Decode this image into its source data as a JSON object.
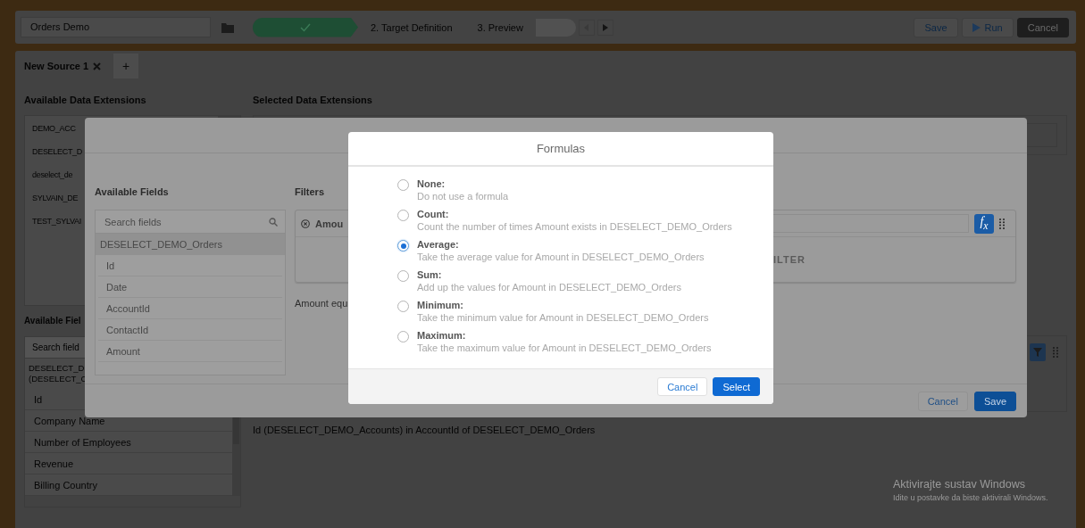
{
  "top_bar": {
    "name_field": "Orders Demo",
    "steps": [
      {
        "completed": true
      },
      {
        "label": "2. Target Definition",
        "completed": false
      },
      {
        "label": "3. Preview",
        "completed": false
      }
    ],
    "actions": [
      {
        "label": "Save",
        "kind": "save"
      },
      {
        "label": "Run",
        "kind": "run"
      },
      {
        "label": "Cancel",
        "kind": "cancel"
      }
    ]
  },
  "source_tabs": {
    "tabs": [
      {
        "label": "New Source 1",
        "selected": true
      }
    ],
    "add_label": "+"
  },
  "available_data_extensions": {
    "title": "Available Data Extensions",
    "items": [
      "DEMO_ACC",
      "DESELECT_D",
      "deselect_de",
      "SYLVAIN_DE",
      "TEST_SYLVAI"
    ]
  },
  "selected_data_extensions": {
    "title": "Selected Data Extensions"
  },
  "available_fields": {
    "title": "Available Fiel",
    "search_placeholder": "Search field",
    "group": "DESELECT_D\n(DESELECT_C",
    "items": [
      "Id",
      "Company Name",
      "Number of Employees",
      "Revenue",
      "Billing Country"
    ]
  },
  "relation": "Id (DESELECT_DEMO_Accounts) in AccountId of DESELECT_DEMO_Orders",
  "filter_value_modal": {
    "available_fields": {
      "title": "Available Fields",
      "search_placeholder": "Search fields",
      "group": "DESELECT_DEMO_Orders",
      "items": [
        "Id",
        "Date",
        "AccountId",
        "ContactId",
        "Amount"
      ]
    },
    "filters": {
      "title": "Filters",
      "field": "Amou",
      "formula_button": "f$_{x}$",
      "add_filter": "ILTER",
      "summary": "Amount equ"
    },
    "buttons": [
      {
        "label": "Cancel",
        "kind": "neutral"
      },
      {
        "label": "Save",
        "kind": "brand"
      }
    ]
  },
  "formulas_modal": {
    "title": "Formulas",
    "options": [
      {
        "label": "None:",
        "description": "Do not use a formula",
        "selected": false
      },
      {
        "label": "Count:",
        "description": "Count the number of times Amount exists in DESELECT_DEMO_Orders",
        "selected": false
      },
      {
        "label": "Average:",
        "description": "Take the average value for Amount in DESELECT_DEMO_Orders",
        "selected": true
      },
      {
        "label": "Sum:",
        "description": "Add up the values for Amount in DESELECT_DEMO_Orders",
        "selected": false
      },
      {
        "label": "Minimum:",
        "description": "Take the minimum value for Amount in DESELECT_DEMO_Orders",
        "selected": false
      },
      {
        "label": "Maximum:",
        "description": "Take the maximum value for Amount in DESELECT_DEMO_Orders",
        "selected": false
      }
    ],
    "buttons": [
      {
        "label": "Cancel",
        "kind": "neutral"
      },
      {
        "label": "Select",
        "kind": "brand"
      }
    ]
  },
  "windows_notice": {
    "title": "Aktivirajte sustav Windows",
    "text": "Idite u postavke da biste aktivirali Windows."
  }
}
